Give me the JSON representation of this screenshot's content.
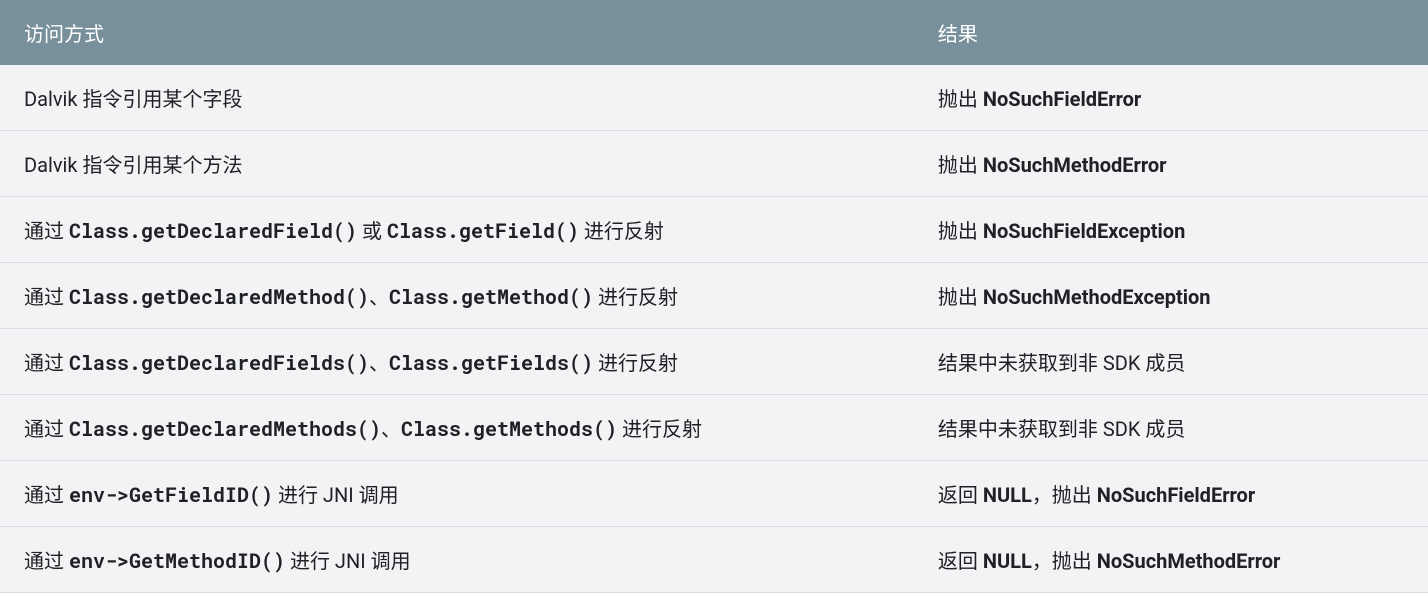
{
  "table": {
    "headers": {
      "method": "访问方式",
      "result": "结果"
    },
    "rows": [
      {
        "method": [
          {
            "text": "Dalvik 指令引用某个字段",
            "mono": false,
            "bold": false
          }
        ],
        "result": [
          {
            "text": "抛出 ",
            "mono": false,
            "bold": false
          },
          {
            "text": "NoSuchFieldError",
            "mono": false,
            "bold": true
          }
        ]
      },
      {
        "method": [
          {
            "text": "Dalvik 指令引用某个方法",
            "mono": false,
            "bold": false
          }
        ],
        "result": [
          {
            "text": "抛出 ",
            "mono": false,
            "bold": false
          },
          {
            "text": "NoSuchMethodError",
            "mono": false,
            "bold": true
          }
        ]
      },
      {
        "method": [
          {
            "text": "通过 ",
            "mono": false,
            "bold": false
          },
          {
            "text": "Class.getDeclaredField()",
            "mono": true,
            "bold": true
          },
          {
            "text": " 或 ",
            "mono": false,
            "bold": false
          },
          {
            "text": "Class.getField()",
            "mono": true,
            "bold": true
          },
          {
            "text": " 进行反射",
            "mono": false,
            "bold": false
          }
        ],
        "result": [
          {
            "text": "抛出 ",
            "mono": false,
            "bold": false
          },
          {
            "text": "NoSuchFieldException",
            "mono": false,
            "bold": true
          }
        ]
      },
      {
        "method": [
          {
            "text": "通过 ",
            "mono": false,
            "bold": false
          },
          {
            "text": "Class.getDeclaredMethod()",
            "mono": true,
            "bold": true
          },
          {
            "text": "、",
            "mono": false,
            "bold": false
          },
          {
            "text": "Class.getMethod()",
            "mono": true,
            "bold": true
          },
          {
            "text": " 进行反射",
            "mono": false,
            "bold": false
          }
        ],
        "result": [
          {
            "text": "抛出 ",
            "mono": false,
            "bold": false
          },
          {
            "text": "NoSuchMethodException",
            "mono": false,
            "bold": true
          }
        ]
      },
      {
        "method": [
          {
            "text": "通过 ",
            "mono": false,
            "bold": false
          },
          {
            "text": "Class.getDeclaredFields()",
            "mono": true,
            "bold": true
          },
          {
            "text": "、",
            "mono": false,
            "bold": false
          },
          {
            "text": "Class.getFields()",
            "mono": true,
            "bold": true
          },
          {
            "text": " 进行反射",
            "mono": false,
            "bold": false
          }
        ],
        "result": [
          {
            "text": "结果中未获取到非 SDK 成员",
            "mono": false,
            "bold": false
          }
        ]
      },
      {
        "method": [
          {
            "text": "通过 ",
            "mono": false,
            "bold": false
          },
          {
            "text": "Class.getDeclaredMethods()",
            "mono": true,
            "bold": true
          },
          {
            "text": "、",
            "mono": false,
            "bold": false
          },
          {
            "text": "Class.getMethods()",
            "mono": true,
            "bold": true
          },
          {
            "text": " 进行反射",
            "mono": false,
            "bold": false
          }
        ],
        "result": [
          {
            "text": "结果中未获取到非 SDK 成员",
            "mono": false,
            "bold": false
          }
        ]
      },
      {
        "method": [
          {
            "text": "通过 ",
            "mono": false,
            "bold": false
          },
          {
            "text": "env->GetFieldID()",
            "mono": true,
            "bold": true
          },
          {
            "text": " 进行 JNI 调用",
            "mono": false,
            "bold": false
          }
        ],
        "result": [
          {
            "text": "返回 ",
            "mono": false,
            "bold": false
          },
          {
            "text": "NULL",
            "mono": false,
            "bold": true
          },
          {
            "text": "，抛出 ",
            "mono": false,
            "bold": false
          },
          {
            "text": "NoSuchFieldError",
            "mono": false,
            "bold": true
          }
        ]
      },
      {
        "method": [
          {
            "text": "通过 ",
            "mono": false,
            "bold": false
          },
          {
            "text": "env->GetMethodID()",
            "mono": true,
            "bold": true
          },
          {
            "text": " 进行 JNI 调用",
            "mono": false,
            "bold": false
          }
        ],
        "result": [
          {
            "text": "返回 ",
            "mono": false,
            "bold": false
          },
          {
            "text": "NULL",
            "mono": false,
            "bold": true
          },
          {
            "text": "，抛出 ",
            "mono": false,
            "bold": false
          },
          {
            "text": "NoSuchMethodError",
            "mono": false,
            "bold": true
          }
        ]
      }
    ]
  }
}
